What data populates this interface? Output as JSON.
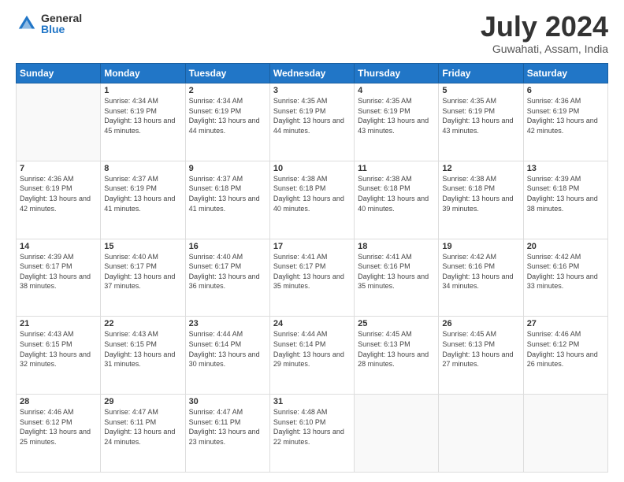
{
  "logo": {
    "general": "General",
    "blue": "Blue"
  },
  "title": "July 2024",
  "location": "Guwahati, Assam, India",
  "days_of_week": [
    "Sunday",
    "Monday",
    "Tuesday",
    "Wednesday",
    "Thursday",
    "Friday",
    "Saturday"
  ],
  "weeks": [
    [
      {
        "day": "",
        "sunrise": "",
        "sunset": "",
        "daylight": ""
      },
      {
        "day": "1",
        "sunrise": "Sunrise: 4:34 AM",
        "sunset": "Sunset: 6:19 PM",
        "daylight": "Daylight: 13 hours and 45 minutes."
      },
      {
        "day": "2",
        "sunrise": "Sunrise: 4:34 AM",
        "sunset": "Sunset: 6:19 PM",
        "daylight": "Daylight: 13 hours and 44 minutes."
      },
      {
        "day": "3",
        "sunrise": "Sunrise: 4:35 AM",
        "sunset": "Sunset: 6:19 PM",
        "daylight": "Daylight: 13 hours and 44 minutes."
      },
      {
        "day": "4",
        "sunrise": "Sunrise: 4:35 AM",
        "sunset": "Sunset: 6:19 PM",
        "daylight": "Daylight: 13 hours and 43 minutes."
      },
      {
        "day": "5",
        "sunrise": "Sunrise: 4:35 AM",
        "sunset": "Sunset: 6:19 PM",
        "daylight": "Daylight: 13 hours and 43 minutes."
      },
      {
        "day": "6",
        "sunrise": "Sunrise: 4:36 AM",
        "sunset": "Sunset: 6:19 PM",
        "daylight": "Daylight: 13 hours and 42 minutes."
      }
    ],
    [
      {
        "day": "7",
        "sunrise": "Sunrise: 4:36 AM",
        "sunset": "Sunset: 6:19 PM",
        "daylight": "Daylight: 13 hours and 42 minutes."
      },
      {
        "day": "8",
        "sunrise": "Sunrise: 4:37 AM",
        "sunset": "Sunset: 6:19 PM",
        "daylight": "Daylight: 13 hours and 41 minutes."
      },
      {
        "day": "9",
        "sunrise": "Sunrise: 4:37 AM",
        "sunset": "Sunset: 6:18 PM",
        "daylight": "Daylight: 13 hours and 41 minutes."
      },
      {
        "day": "10",
        "sunrise": "Sunrise: 4:38 AM",
        "sunset": "Sunset: 6:18 PM",
        "daylight": "Daylight: 13 hours and 40 minutes."
      },
      {
        "day": "11",
        "sunrise": "Sunrise: 4:38 AM",
        "sunset": "Sunset: 6:18 PM",
        "daylight": "Daylight: 13 hours and 40 minutes."
      },
      {
        "day": "12",
        "sunrise": "Sunrise: 4:38 AM",
        "sunset": "Sunset: 6:18 PM",
        "daylight": "Daylight: 13 hours and 39 minutes."
      },
      {
        "day": "13",
        "sunrise": "Sunrise: 4:39 AM",
        "sunset": "Sunset: 6:18 PM",
        "daylight": "Daylight: 13 hours and 38 minutes."
      }
    ],
    [
      {
        "day": "14",
        "sunrise": "Sunrise: 4:39 AM",
        "sunset": "Sunset: 6:17 PM",
        "daylight": "Daylight: 13 hours and 38 minutes."
      },
      {
        "day": "15",
        "sunrise": "Sunrise: 4:40 AM",
        "sunset": "Sunset: 6:17 PM",
        "daylight": "Daylight: 13 hours and 37 minutes."
      },
      {
        "day": "16",
        "sunrise": "Sunrise: 4:40 AM",
        "sunset": "Sunset: 6:17 PM",
        "daylight": "Daylight: 13 hours and 36 minutes."
      },
      {
        "day": "17",
        "sunrise": "Sunrise: 4:41 AM",
        "sunset": "Sunset: 6:17 PM",
        "daylight": "Daylight: 13 hours and 35 minutes."
      },
      {
        "day": "18",
        "sunrise": "Sunrise: 4:41 AM",
        "sunset": "Sunset: 6:16 PM",
        "daylight": "Daylight: 13 hours and 35 minutes."
      },
      {
        "day": "19",
        "sunrise": "Sunrise: 4:42 AM",
        "sunset": "Sunset: 6:16 PM",
        "daylight": "Daylight: 13 hours and 34 minutes."
      },
      {
        "day": "20",
        "sunrise": "Sunrise: 4:42 AM",
        "sunset": "Sunset: 6:16 PM",
        "daylight": "Daylight: 13 hours and 33 minutes."
      }
    ],
    [
      {
        "day": "21",
        "sunrise": "Sunrise: 4:43 AM",
        "sunset": "Sunset: 6:15 PM",
        "daylight": "Daylight: 13 hours and 32 minutes."
      },
      {
        "day": "22",
        "sunrise": "Sunrise: 4:43 AM",
        "sunset": "Sunset: 6:15 PM",
        "daylight": "Daylight: 13 hours and 31 minutes."
      },
      {
        "day": "23",
        "sunrise": "Sunrise: 4:44 AM",
        "sunset": "Sunset: 6:14 PM",
        "daylight": "Daylight: 13 hours and 30 minutes."
      },
      {
        "day": "24",
        "sunrise": "Sunrise: 4:44 AM",
        "sunset": "Sunset: 6:14 PM",
        "daylight": "Daylight: 13 hours and 29 minutes."
      },
      {
        "day": "25",
        "sunrise": "Sunrise: 4:45 AM",
        "sunset": "Sunset: 6:13 PM",
        "daylight": "Daylight: 13 hours and 28 minutes."
      },
      {
        "day": "26",
        "sunrise": "Sunrise: 4:45 AM",
        "sunset": "Sunset: 6:13 PM",
        "daylight": "Daylight: 13 hours and 27 minutes."
      },
      {
        "day": "27",
        "sunrise": "Sunrise: 4:46 AM",
        "sunset": "Sunset: 6:12 PM",
        "daylight": "Daylight: 13 hours and 26 minutes."
      }
    ],
    [
      {
        "day": "28",
        "sunrise": "Sunrise: 4:46 AM",
        "sunset": "Sunset: 6:12 PM",
        "daylight": "Daylight: 13 hours and 25 minutes."
      },
      {
        "day": "29",
        "sunrise": "Sunrise: 4:47 AM",
        "sunset": "Sunset: 6:11 PM",
        "daylight": "Daylight: 13 hours and 24 minutes."
      },
      {
        "day": "30",
        "sunrise": "Sunrise: 4:47 AM",
        "sunset": "Sunset: 6:11 PM",
        "daylight": "Daylight: 13 hours and 23 minutes."
      },
      {
        "day": "31",
        "sunrise": "Sunrise: 4:48 AM",
        "sunset": "Sunset: 6:10 PM",
        "daylight": "Daylight: 13 hours and 22 minutes."
      },
      {
        "day": "",
        "sunrise": "",
        "sunset": "",
        "daylight": ""
      },
      {
        "day": "",
        "sunrise": "",
        "sunset": "",
        "daylight": ""
      },
      {
        "day": "",
        "sunrise": "",
        "sunset": "",
        "daylight": ""
      }
    ]
  ]
}
